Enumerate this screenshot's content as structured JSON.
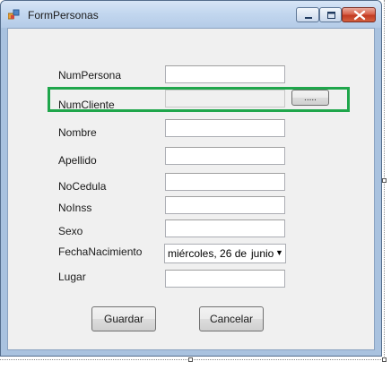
{
  "window": {
    "title": "FormPersonas",
    "icon": "windows-form-icon",
    "controls": [
      "minimize-icon",
      "maximize-icon",
      "close-icon"
    ]
  },
  "form": {
    "fields": {
      "num_persona": {
        "label": "NumPersona",
        "value": ""
      },
      "num_cliente": {
        "label": "NumCliente",
        "value": "",
        "browse_label": "....."
      },
      "nombre": {
        "label": "Nombre",
        "value": ""
      },
      "apellido": {
        "label": "Apellido",
        "value": ""
      },
      "no_cedula": {
        "label": "NoCedula",
        "value": ""
      },
      "no_inss": {
        "label": "NoInss",
        "value": ""
      },
      "sexo": {
        "label": "Sexo",
        "value": ""
      },
      "fecha_nacimiento": {
        "label": "FechaNacimiento",
        "day_text": "miércoles, 26 de",
        "month_text": "junio"
      },
      "lugar": {
        "label": "Lugar",
        "value": ""
      }
    },
    "buttons": {
      "save_label": "Guardar",
      "cancel_label": "Cancelar"
    }
  },
  "colors": {
    "highlight": "#1fa64b",
    "client_background": "#f0f0f0",
    "close_button": "#c23a22"
  }
}
